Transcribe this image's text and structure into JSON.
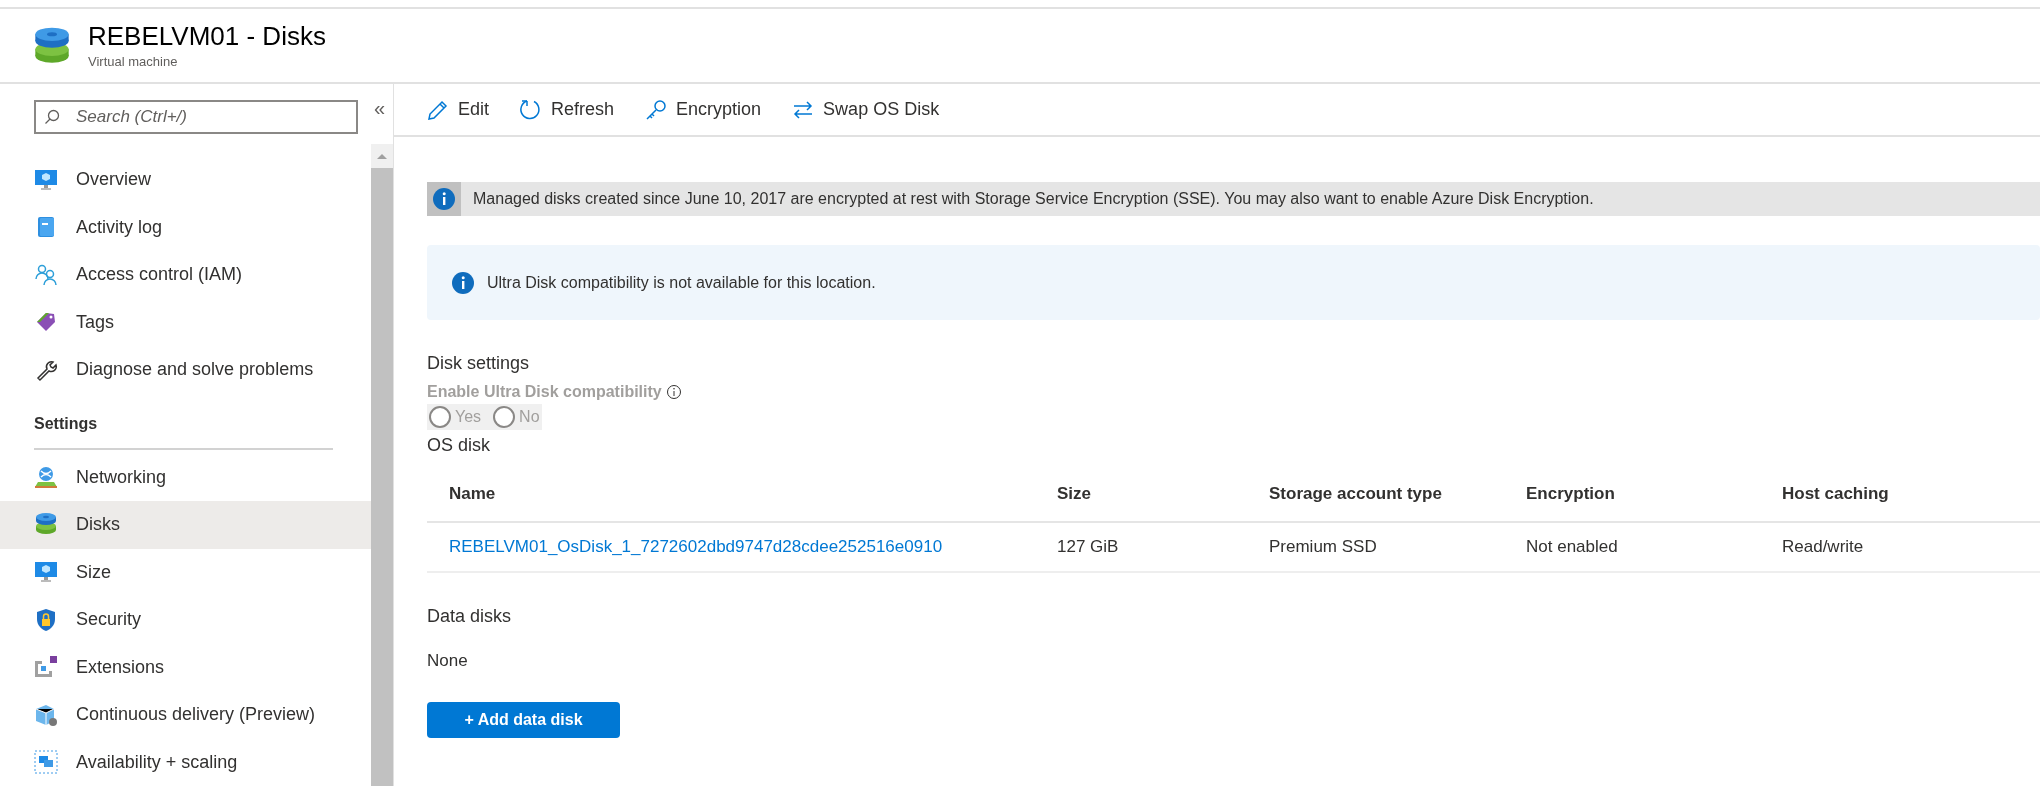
{
  "header": {
    "title": "REBELVM01 - Disks",
    "subtitle": "Virtual machine"
  },
  "sidebar": {
    "search": {
      "placeholder": "Search (Ctrl+/)"
    },
    "collapse": "«",
    "groups": [
      {
        "items": [
          {
            "label": "Overview",
            "selected": false
          },
          {
            "label": "Activity log",
            "selected": false
          },
          {
            "label": "Access control (IAM)",
            "selected": false
          },
          {
            "label": "Tags",
            "selected": false
          },
          {
            "label": "Diagnose and solve problems",
            "selected": false
          }
        ]
      },
      {
        "heading": "Settings",
        "items": [
          {
            "label": "Networking",
            "selected": false
          },
          {
            "label": "Disks",
            "selected": true
          },
          {
            "label": "Size",
            "selected": false
          },
          {
            "label": "Security",
            "selected": false
          },
          {
            "label": "Extensions",
            "selected": false
          },
          {
            "label": "Continuous delivery (Preview)",
            "selected": false
          },
          {
            "label": "Availability + scaling",
            "selected": false
          }
        ]
      }
    ]
  },
  "toolbar": [
    {
      "label": "Edit"
    },
    {
      "label": "Refresh"
    },
    {
      "label": "Encryption"
    },
    {
      "label": "Swap OS Disk"
    }
  ],
  "notices": [
    {
      "kind": "gray",
      "text": "Managed disks created since June 10, 2017 are encrypted at rest with Storage Service Encryption (SSE). You may also want to enable Azure Disk Encryption."
    },
    {
      "kind": "blue",
      "text": "Ultra Disk compatibility is not available for this location."
    }
  ],
  "disk_settings": {
    "title": "Disk settings",
    "field_label": "Enable Ultra Disk compatibility",
    "disabled": true,
    "options": [
      {
        "label": "Yes",
        "selected": false
      },
      {
        "label": "No",
        "selected": false
      }
    ]
  },
  "os_disk": {
    "title": "OS disk",
    "columns": [
      "Name",
      "Size",
      "Storage account type",
      "Encryption",
      "Host caching"
    ],
    "rows": [
      [
        "REBELVM01_OsDisk_1_7272602dbd9747d28cdee252516e0910",
        "127 GiB",
        "Premium SSD",
        "Not enabled",
        "Read/write"
      ]
    ]
  },
  "data_disks": {
    "title": "Data disks",
    "empty": "None",
    "add_button": "+ Add data disk"
  }
}
